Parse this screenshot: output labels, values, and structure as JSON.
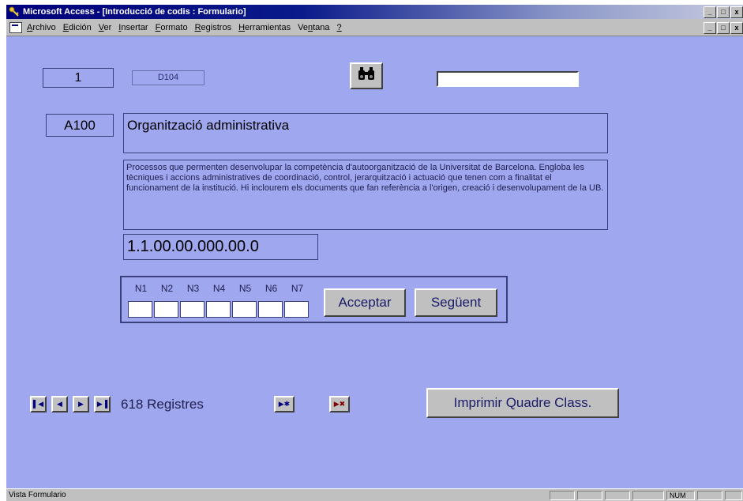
{
  "window": {
    "title": "Microsoft Access - [Introducció de codis : Formulario]",
    "controls": [
      "_",
      "□",
      "x"
    ]
  },
  "menu": [
    {
      "label": "Archivo",
      "key": "A"
    },
    {
      "label": "Edición",
      "key": "E"
    },
    {
      "label": "Ver",
      "key": "V"
    },
    {
      "label": "Insertar",
      "key": "I"
    },
    {
      "label": "Formato",
      "key": "F"
    },
    {
      "label": "Registros",
      "key": "R"
    },
    {
      "label": "Herramientas",
      "key": "H"
    },
    {
      "label": "Ventana",
      "key": "n"
    },
    {
      "label": "?",
      "key": "?"
    }
  ],
  "form": {
    "record_number": "1",
    "code_ref": "D104",
    "search_value": "",
    "code": "A100",
    "title": "Organització administrativa",
    "description": "Processos que permenten desenvolupar la competència d'autoorganització de la Universitat de Barcelona. Engloba les tècniques i accions administratives de coordinació, control, jerarquització i actuació que tenen com a finalitat el funcionament de la institució.  Hi inclourem els documents que fan referència a l'origen, creació i desenvolupament de la UB.",
    "classification": "1.1.00.00.000.00.0",
    "levels": [
      "N1",
      "N2",
      "N3",
      "N4",
      "N5",
      "N6",
      "N7"
    ],
    "accept_label": "Acceptar",
    "next_label": "Següent",
    "records_label": "618 Registres",
    "print_label": "Imprimir Quadre Class."
  },
  "status": {
    "text": "Vista Formulario",
    "num": "NUM"
  },
  "colors": {
    "form_background": "#9fa7ef",
    "title_bar": "#00007c"
  }
}
